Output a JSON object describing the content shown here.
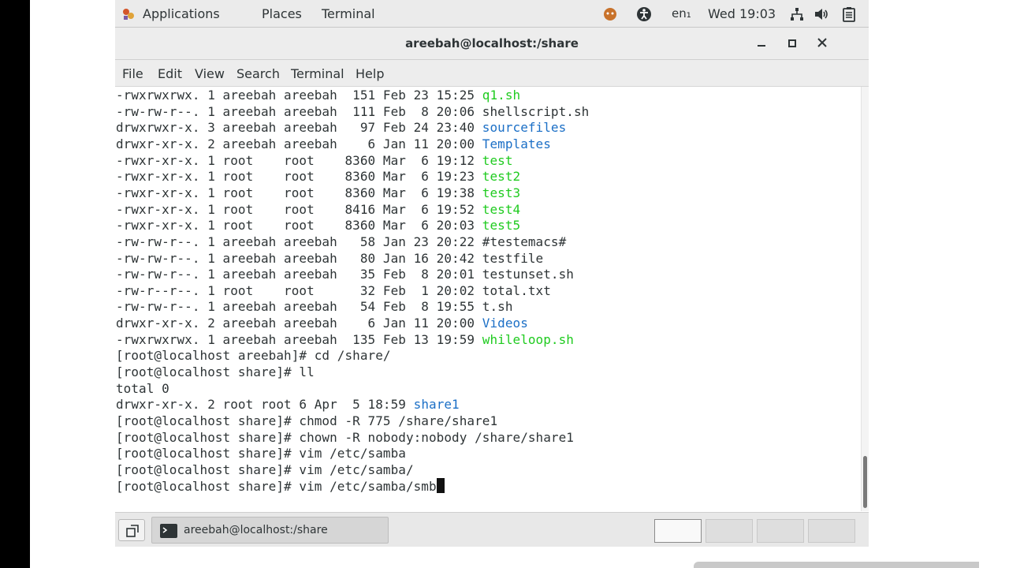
{
  "topbar": {
    "applications": "Applications",
    "places": "Places",
    "terminal": "Terminal",
    "lang": "en₁",
    "clock": "Wed 19:03",
    "icons": [
      "notification-icon",
      "accessibility-icon",
      "network-icon",
      "volume-icon",
      "battery-icon"
    ]
  },
  "window": {
    "title": "areebah@localhost:/share",
    "menu": [
      "File",
      "Edit",
      "View",
      "Search",
      "Terminal",
      "Help"
    ]
  },
  "terminal": {
    "lines": [
      {
        "prefix": "-rwxrwxrwx. 1 areebah areebah  151 Feb 23 15:25 ",
        "name": "q1.sh",
        "kind": "exec"
      },
      {
        "prefix": "-rw-rw-r--. 1 areebah areebah  111 Feb  8 20:06 ",
        "name": "shellscript.sh",
        "kind": "plain"
      },
      {
        "prefix": "drwxrwxr-x. 3 areebah areebah   97 Feb 24 23:40 ",
        "name": "sourcefiles",
        "kind": "dir"
      },
      {
        "prefix": "drwxr-xr-x. 2 areebah areebah    6 Jan 11 20:00 ",
        "name": "Templates",
        "kind": "dir"
      },
      {
        "prefix": "-rwxr-xr-x. 1 root    root    8360 Mar  6 19:12 ",
        "name": "test",
        "kind": "exec"
      },
      {
        "prefix": "-rwxr-xr-x. 1 root    root    8360 Mar  6 19:23 ",
        "name": "test2",
        "kind": "exec"
      },
      {
        "prefix": "-rwxr-xr-x. 1 root    root    8360 Mar  6 19:38 ",
        "name": "test3",
        "kind": "exec"
      },
      {
        "prefix": "-rwxr-xr-x. 1 root    root    8416 Mar  6 19:52 ",
        "name": "test4",
        "kind": "exec"
      },
      {
        "prefix": "-rwxr-xr-x. 1 root    root    8360 Mar  6 20:03 ",
        "name": "test5",
        "kind": "exec"
      },
      {
        "prefix": "-rw-rw-r--. 1 areebah areebah   58 Jan 23 20:22 ",
        "name": "#testemacs#",
        "kind": "plain"
      },
      {
        "prefix": "-rw-rw-r--. 1 areebah areebah   80 Jan 16 20:42 ",
        "name": "testfile",
        "kind": "plain"
      },
      {
        "prefix": "-rw-rw-r--. 1 areebah areebah   35 Feb  8 20:01 ",
        "name": "testunset.sh",
        "kind": "plain"
      },
      {
        "prefix": "-rw-r--r--. 1 root    root      32 Feb  1 20:02 ",
        "name": "total.txt",
        "kind": "plain"
      },
      {
        "prefix": "-rw-rw-r--. 1 areebah areebah   54 Feb  8 19:55 ",
        "name": "t.sh",
        "kind": "plain"
      },
      {
        "prefix": "drwxr-xr-x. 2 areebah areebah    6 Jan 11 20:00 ",
        "name": "Videos",
        "kind": "dir"
      },
      {
        "prefix": "-rwxrwxrwx. 1 areebah areebah  135 Feb 13 19:59 ",
        "name": "whileloop.sh",
        "kind": "exec"
      },
      {
        "prefix": "[root@localhost areebah]# cd /share/",
        "name": "",
        "kind": "plain"
      },
      {
        "prefix": "[root@localhost share]# ll",
        "name": "",
        "kind": "plain"
      },
      {
        "prefix": "total 0",
        "name": "",
        "kind": "plain"
      },
      {
        "prefix": "drwxr-xr-x. 2 root root 6 Apr  5 18:59 ",
        "name": "share1",
        "kind": "dir"
      },
      {
        "prefix": "[root@localhost share]# chmod -R 775 /share/share1",
        "name": "",
        "kind": "plain"
      },
      {
        "prefix": "[root@localhost share]# chown -R nobody:nobody /share/share1",
        "name": "",
        "kind": "plain"
      },
      {
        "prefix": "[root@localhost share]# vim /etc/samba",
        "name": "",
        "kind": "plain"
      },
      {
        "prefix": "[root@localhost share]# vim /etc/samba/",
        "name": "",
        "kind": "plain"
      },
      {
        "prefix": "[root@localhost share]# vim /etc/samba/smb",
        "name": "",
        "kind": "plain"
      }
    ]
  },
  "taskbar": {
    "task_label": "areebah@localhost:/share",
    "workspace_count": 4,
    "active_workspace": 1
  }
}
